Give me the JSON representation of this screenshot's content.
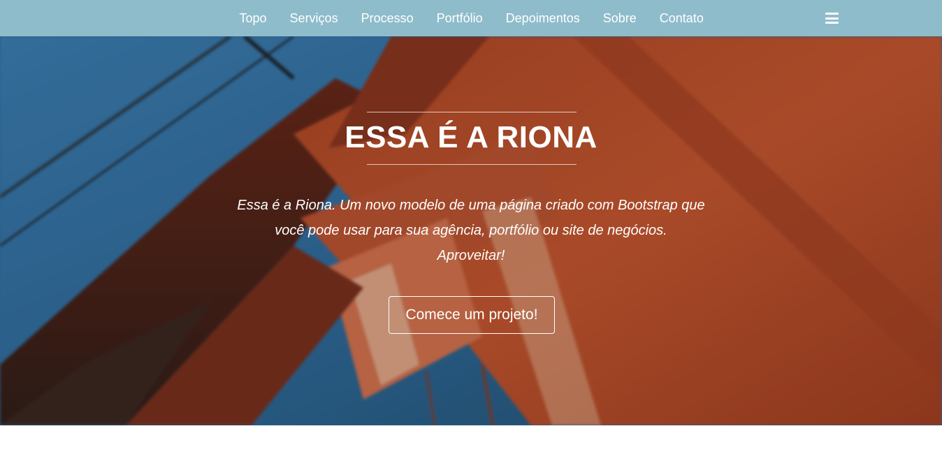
{
  "nav": {
    "items": [
      {
        "label": "Topo"
      },
      {
        "label": "Serviços"
      },
      {
        "label": "Processo"
      },
      {
        "label": "Portfólio"
      },
      {
        "label": "Depoimentos"
      },
      {
        "label": "Sobre"
      },
      {
        "label": "Contato"
      }
    ],
    "menu_icon": "hamburger-menu-icon",
    "background_color": "#8fbccb"
  },
  "hero": {
    "title": "ESSA É A RIONA",
    "text_line1": "Essa é a Riona. Um novo modelo de uma página criado com Bootstrap que",
    "text_line2": "você pode usar para sua agência, portfólio ou site de negócios.",
    "text_line3": "Aproveitar!",
    "cta_label": "Comece um projeto!",
    "image": "bridge-tower-photo"
  }
}
